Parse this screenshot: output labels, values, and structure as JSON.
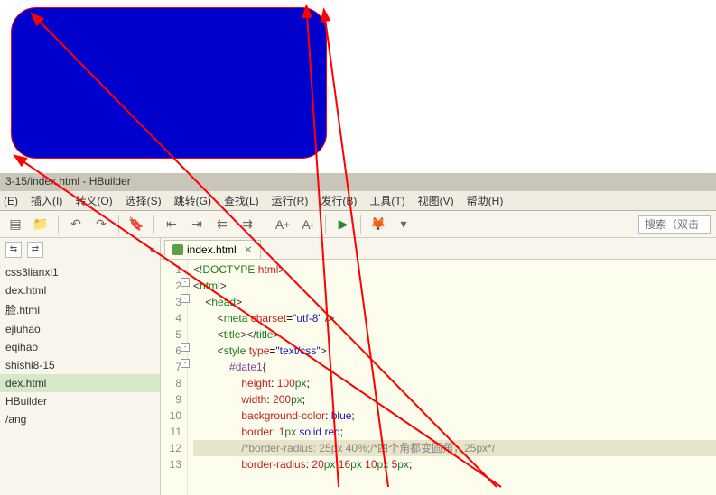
{
  "preview": {
    "box_style_note": "blue rounded box with red border"
  },
  "title_bar": "3-15/index.html - HBuilder",
  "menu": [
    "(E)",
    "插入(I)",
    "转义(O)",
    "选择(S)",
    "跳转(G)",
    "查找(L)",
    "运行(R)",
    "发行(B)",
    "工具(T)",
    "视图(V)",
    "帮助(H)"
  ],
  "toolbar_icons": [
    "new",
    "open",
    "sep",
    "undo",
    "redo",
    "sep",
    "bookmark",
    "sep",
    "outdent",
    "indent",
    "out2",
    "in2",
    "sep",
    "fontplus",
    "fontminus",
    "sep",
    "run",
    "sep",
    "firefox",
    "chrome"
  ],
  "search_placeholder": "搜索（双击",
  "sidebar_items": [
    {
      "label": "css3lianxi1",
      "sel": false
    },
    {
      "label": "dex.html",
      "sel": false
    },
    {
      "label": "脸.html",
      "sel": false
    },
    {
      "label": "ejiuhao",
      "sel": false
    },
    {
      "label": "eqihao",
      "sel": false
    },
    {
      "label": "shishi8-15",
      "sel": false
    },
    {
      "label": "dex.html",
      "sel": true
    },
    {
      "label": "HBuilder",
      "sel": false
    },
    {
      "label": "/ang",
      "sel": false
    }
  ],
  "tab": {
    "label": "index.html",
    "close": "✕"
  },
  "code_lines": [
    {
      "n": 1,
      "html": "<span class='c-punc'>&lt;</span><span class='c-tag'>!DOCTYPE</span> <span class='c-attr'>html</span><span class='c-punc'>&gt;</span>"
    },
    {
      "n": 2,
      "html": "<span class='c-punc'>&lt;</span><span class='c-tag'>html</span><span class='c-punc'>&gt;</span>",
      "fold": "-"
    },
    {
      "n": 3,
      "html": "    <span class='c-punc'>&lt;</span><span class='c-tag'>head</span><span class='c-punc'>&gt;</span>",
      "fold": "-"
    },
    {
      "n": 4,
      "html": "        <span class='c-punc'>&lt;</span><span class='c-tag'>meta</span> <span class='c-attr'>charset</span>=<span class='c-str'>\"utf-8\"</span> <span class='c-punc'>/&gt;</span>"
    },
    {
      "n": 5,
      "html": "        <span class='c-punc'>&lt;</span><span class='c-tag'>title</span><span class='c-punc'>&gt;&lt;/</span><span class='c-tag'>title</span><span class='c-punc'>&gt;</span>"
    },
    {
      "n": 6,
      "html": "        <span class='c-punc'>&lt;</span><span class='c-tag'>style</span> <span class='c-attr'>type</span>=<span class='c-str'>\"text/css\"</span><span class='c-punc'>&gt;</span>",
      "fold": "-"
    },
    {
      "n": 7,
      "html": "            <span class='c-sel'>#date1</span><span class='c-punc'>{</span>",
      "fold": "-"
    },
    {
      "n": 8,
      "html": "                <span class='c-prop'>height</span>: <span class='c-num'>100</span><span class='c-unit'>px</span>;"
    },
    {
      "n": 9,
      "html": "                <span class='c-prop'>width</span>: <span class='c-num'>200</span><span class='c-unit'>px</span>;"
    },
    {
      "n": 10,
      "html": "                <span class='c-prop'>background-color</span>: <span class='c-val'>blue</span>;"
    },
    {
      "n": 11,
      "html": "                <span class='c-prop'>border</span>: <span class='c-num'>1</span><span class='c-unit'>px</span> <span class='c-val'>solid</span> <span class='c-val'>red</span>;"
    },
    {
      "n": 12,
      "html": "                <span class='c-comment'>/*border-radius: 25px 40%;/*四个角都变圆角，25px*/</span>",
      "hl": true
    },
    {
      "n": 13,
      "html": "                <span class='c-prop'>border-radius</span>: <span class='c-num'>20</span><span class='c-unit'>px</span> <span class='c-num'>16</span><span class='c-unit'>px</span> <span class='c-num'>10</span><span class='c-unit'>px</span> <span class='c-num'>5</span><span class='c-unit'>px</span>;"
    }
  ]
}
